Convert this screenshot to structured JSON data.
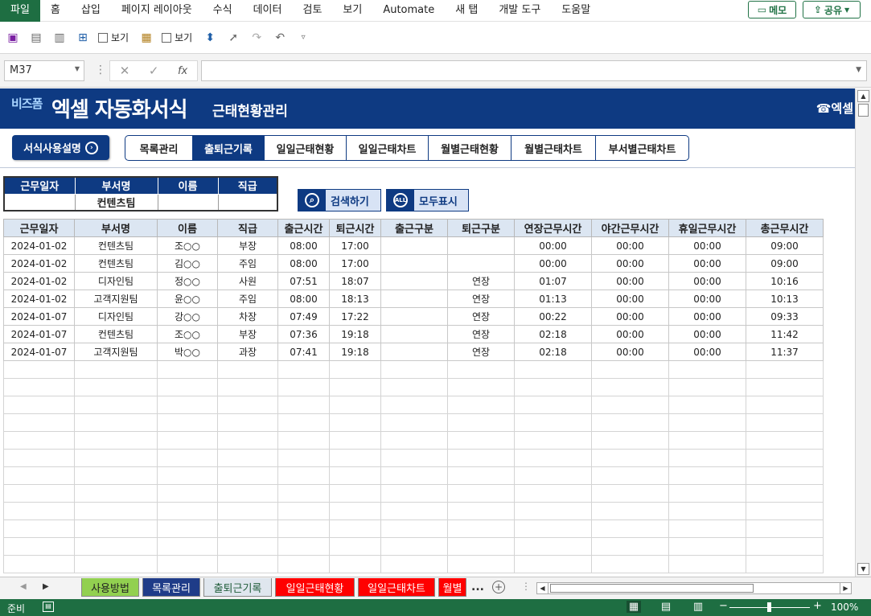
{
  "ribbon": {
    "tabs": [
      "파일",
      "홈",
      "삽입",
      "페이지 레이아웃",
      "수식",
      "데이터",
      "검토",
      "보기",
      "Automate",
      "새 탭",
      "개발 도구",
      "도움말"
    ],
    "active_tab": "파일",
    "memo_label": "메모",
    "share_label": "공유"
  },
  "quick_toolbar": {
    "view_checkbox1": "보기",
    "view_checkbox2": "보기"
  },
  "formula_bar": {
    "name_box": "M37",
    "fx_label": "fx",
    "formula": ""
  },
  "banner": {
    "logo_small": "비즈폼",
    "logo_main": "엑셀 자동화서식",
    "subtitle": "근태현황관리",
    "right_logo": "엑셀"
  },
  "guide_button": "서식사용설명",
  "nav_tabs": [
    {
      "label": "목록관리",
      "active": false
    },
    {
      "label": "출퇴근기록",
      "active": true
    },
    {
      "label": "일일근태현황",
      "active": false
    },
    {
      "label": "일일근태차트",
      "active": false
    },
    {
      "label": "월별근태현황",
      "active": false
    },
    {
      "label": "월별근태차트",
      "active": false
    },
    {
      "label": "부서별근태차트",
      "active": false
    }
  ],
  "filter": {
    "headers": [
      "근무일자",
      "부서명",
      "이름",
      "직급"
    ],
    "values": [
      "",
      "컨텐츠팀",
      "",
      ""
    ]
  },
  "search_button": "검색하기",
  "all_button": "모두표시",
  "all_icon_text": "ALL",
  "table": {
    "headers": [
      "근무일자",
      "부서명",
      "이름",
      "직급",
      "출근시간",
      "퇴근시간",
      "출근구분",
      "퇴근구분",
      "연장근무시간",
      "야간근무시간",
      "휴일근무시간",
      "총근무시간"
    ],
    "rows": [
      [
        "2024-01-02",
        "컨텐츠팀",
        "조○○",
        "부장",
        "08:00",
        "17:00",
        "",
        "",
        "00:00",
        "00:00",
        "00:00",
        "09:00"
      ],
      [
        "2024-01-02",
        "컨텐츠팀",
        "김○○",
        "주임",
        "08:00",
        "17:00",
        "",
        "",
        "00:00",
        "00:00",
        "00:00",
        "09:00"
      ],
      [
        "2024-01-02",
        "디자인팀",
        "정○○",
        "사원",
        "07:51",
        "18:07",
        "",
        "연장",
        "01:07",
        "00:00",
        "00:00",
        "10:16"
      ],
      [
        "2024-01-02",
        "고객지원팀",
        "윤○○",
        "주임",
        "08:00",
        "18:13",
        "",
        "연장",
        "01:13",
        "00:00",
        "00:00",
        "10:13"
      ],
      [
        "2024-01-07",
        "디자인팀",
        "강○○",
        "차장",
        "07:49",
        "17:22",
        "",
        "연장",
        "00:22",
        "00:00",
        "00:00",
        "09:33"
      ],
      [
        "2024-01-07",
        "컨텐츠팀",
        "조○○",
        "부장",
        "07:36",
        "19:18",
        "",
        "연장",
        "02:18",
        "00:00",
        "00:00",
        "11:42"
      ],
      [
        "2024-01-07",
        "고객지원팀",
        "박○○",
        "과장",
        "07:41",
        "19:18",
        "",
        "연장",
        "02:18",
        "00:00",
        "00:00",
        "11:37"
      ]
    ]
  },
  "sheet_tabs": [
    {
      "label": "사용방법",
      "color": "#92d050",
      "text_color": "#222222"
    },
    {
      "label": "목록관리",
      "color": "#1f3c88",
      "text_color": "#ffffff"
    },
    {
      "label": "출퇴근기록",
      "color": "#dfe6ee",
      "text_color": "#1e5b38"
    },
    {
      "label": "일일근태현황",
      "color": "#ff0000",
      "text_color": "#ffffff"
    },
    {
      "label": "일일근태차트",
      "color": "#ff0000",
      "text_color": "#ffffff"
    },
    {
      "label": "월별",
      "color": "#ff0000",
      "text_color": "#ffffff"
    }
  ],
  "sheet_tabs_more": "...",
  "status": {
    "ready": "준비",
    "zoom": "100%"
  }
}
